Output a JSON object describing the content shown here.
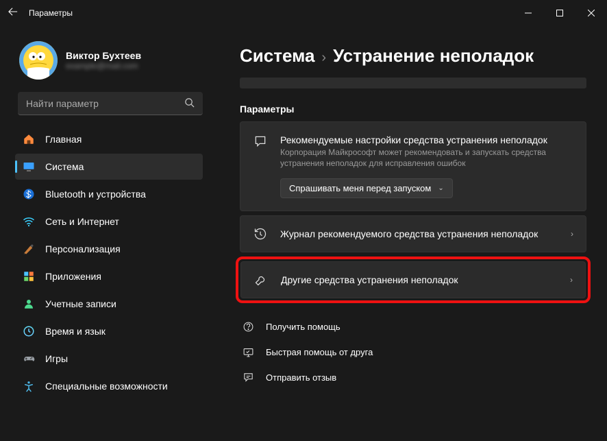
{
  "titlebar": {
    "title": "Параметры"
  },
  "profile": {
    "name": "Виктор Бухтеев",
    "email": "example@mail.com"
  },
  "search": {
    "placeholder": "Найти параметр"
  },
  "nav": {
    "items": [
      {
        "id": "home",
        "label": "Главная"
      },
      {
        "id": "system",
        "label": "Система"
      },
      {
        "id": "bluetooth",
        "label": "Bluetooth и устройства"
      },
      {
        "id": "network",
        "label": "Сеть и Интернет"
      },
      {
        "id": "personal",
        "label": "Персонализация"
      },
      {
        "id": "apps",
        "label": "Приложения"
      },
      {
        "id": "accounts",
        "label": "Учетные записи"
      },
      {
        "id": "time",
        "label": "Время и язык"
      },
      {
        "id": "gaming",
        "label": "Игры"
      },
      {
        "id": "access",
        "label": "Специальные возможности"
      }
    ],
    "selected": "system"
  },
  "breadcrumb": {
    "root": "Система",
    "leaf": "Устранение неполадок"
  },
  "section_label": "Параметры",
  "card_rec": {
    "title": "Рекомендуемые настройки средства устранения неполадок",
    "sub": "Корпорация Майкрософт может рекомендовать и запускать средства устранения неполадок для исправления ошибок",
    "dropdown": "Спрашивать меня перед запуском"
  },
  "card_history": {
    "title": "Журнал рекомендуемого средства устранения неполадок"
  },
  "card_other": {
    "title": "Другие средства устранения неполадок"
  },
  "links": {
    "help": "Получить помощь",
    "quick": "Быстрая помощь от друга",
    "feedback": "Отправить отзыв"
  }
}
